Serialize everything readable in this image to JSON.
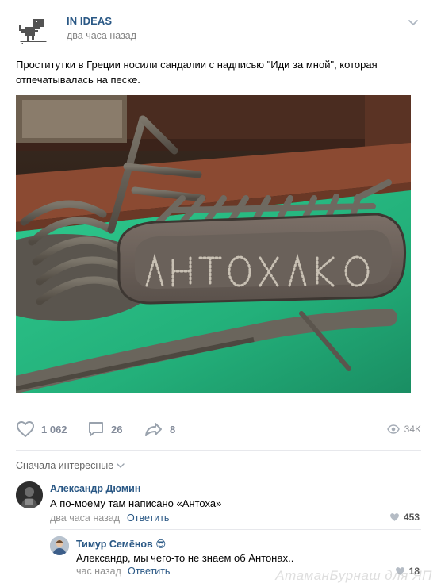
{
  "post": {
    "community_name": "IN IDEAS",
    "time": "два часа назад",
    "text": "Проститутки в Греции носили сандалии с надписью \"Иди за мной\", которая отпечатывалась на песке.",
    "photo_sole_lettering": "АНТОХА"
  },
  "actions": {
    "likes": "1 062",
    "comments": "26",
    "shares": "8",
    "views": "34K"
  },
  "comments_sort": "Сначала интересные",
  "comments": [
    {
      "author": "Александр Дюмин",
      "text": "А по-моему там написано «Антоха»",
      "time": "два часа назад",
      "reply_label": "Ответить",
      "likes": "453"
    },
    {
      "author": "Тимур Семёнов",
      "emoji": "😎",
      "text": "Александр, мы чего-то не знаем об Антонах..",
      "time": "час назад",
      "reply_label": "Ответить",
      "likes": "18"
    }
  ],
  "watermark": "АтаманБурнаш для ЯП",
  "colors": {
    "link": "#2a5885",
    "muted": "#828282",
    "separator": "#e7e8ec",
    "action_icon": "#99a2ad"
  }
}
